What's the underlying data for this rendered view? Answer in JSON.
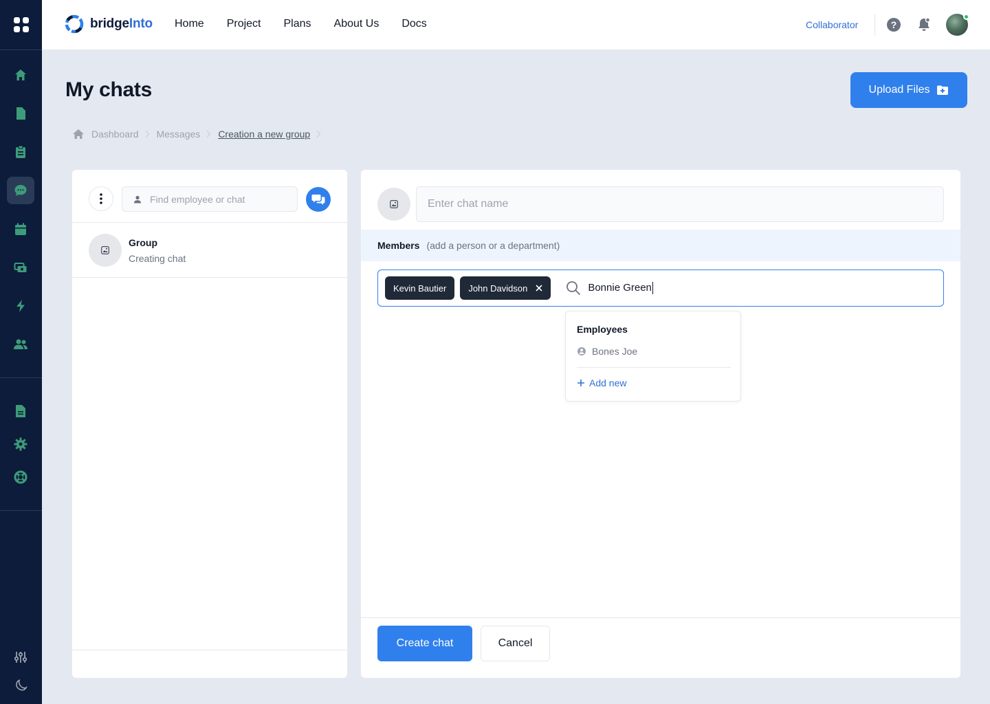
{
  "brand": {
    "name_part1": "bridge",
    "name_part2": "Into"
  },
  "nav": [
    "Home",
    "Project",
    "Plans",
    "About Us",
    "Docs"
  ],
  "topbar": {
    "role_link": "Collaborator"
  },
  "sidebar": {
    "items": [
      {
        "icon": "home-icon"
      },
      {
        "icon": "document-icon"
      },
      {
        "icon": "clipboard-icon"
      },
      {
        "icon": "chat-icon",
        "active": true
      },
      {
        "icon": "calendar-icon"
      },
      {
        "icon": "cash-icon"
      },
      {
        "icon": "lightning-icon"
      },
      {
        "icon": "users-icon"
      },
      {
        "icon": "file-text-icon"
      },
      {
        "icon": "settings-icon"
      },
      {
        "icon": "support-icon"
      },
      {
        "icon": "sliders-icon"
      },
      {
        "icon": "moon-icon"
      }
    ]
  },
  "page": {
    "title": "My chats",
    "upload_label": "Upload Files"
  },
  "breadcrumb": [
    "Dashboard",
    "Messages",
    "Creation a new group"
  ],
  "left": {
    "search_placeholder": "Find employee or chat",
    "chat_name": "Group",
    "chat_sub": "Creating chat"
  },
  "right": {
    "chat_name_placeholder": "Enter chat name",
    "members_label": "Members",
    "members_hint": "(add a person or a department)",
    "chips": [
      "Kevin Bautier",
      "John Davidson"
    ],
    "search_value": "Bonnie Green",
    "dropdown": {
      "title": "Employees",
      "item": "Bones Joe",
      "add_label": "Add new"
    },
    "create_label": "Create chat",
    "cancel_label": "Cancel"
  },
  "colors": {
    "sidebar_bg": "#0c1c3a",
    "sidebar_icon": "#3d9b7a",
    "primary": "#2f80ed",
    "page_bg": "#e4e9f1"
  }
}
